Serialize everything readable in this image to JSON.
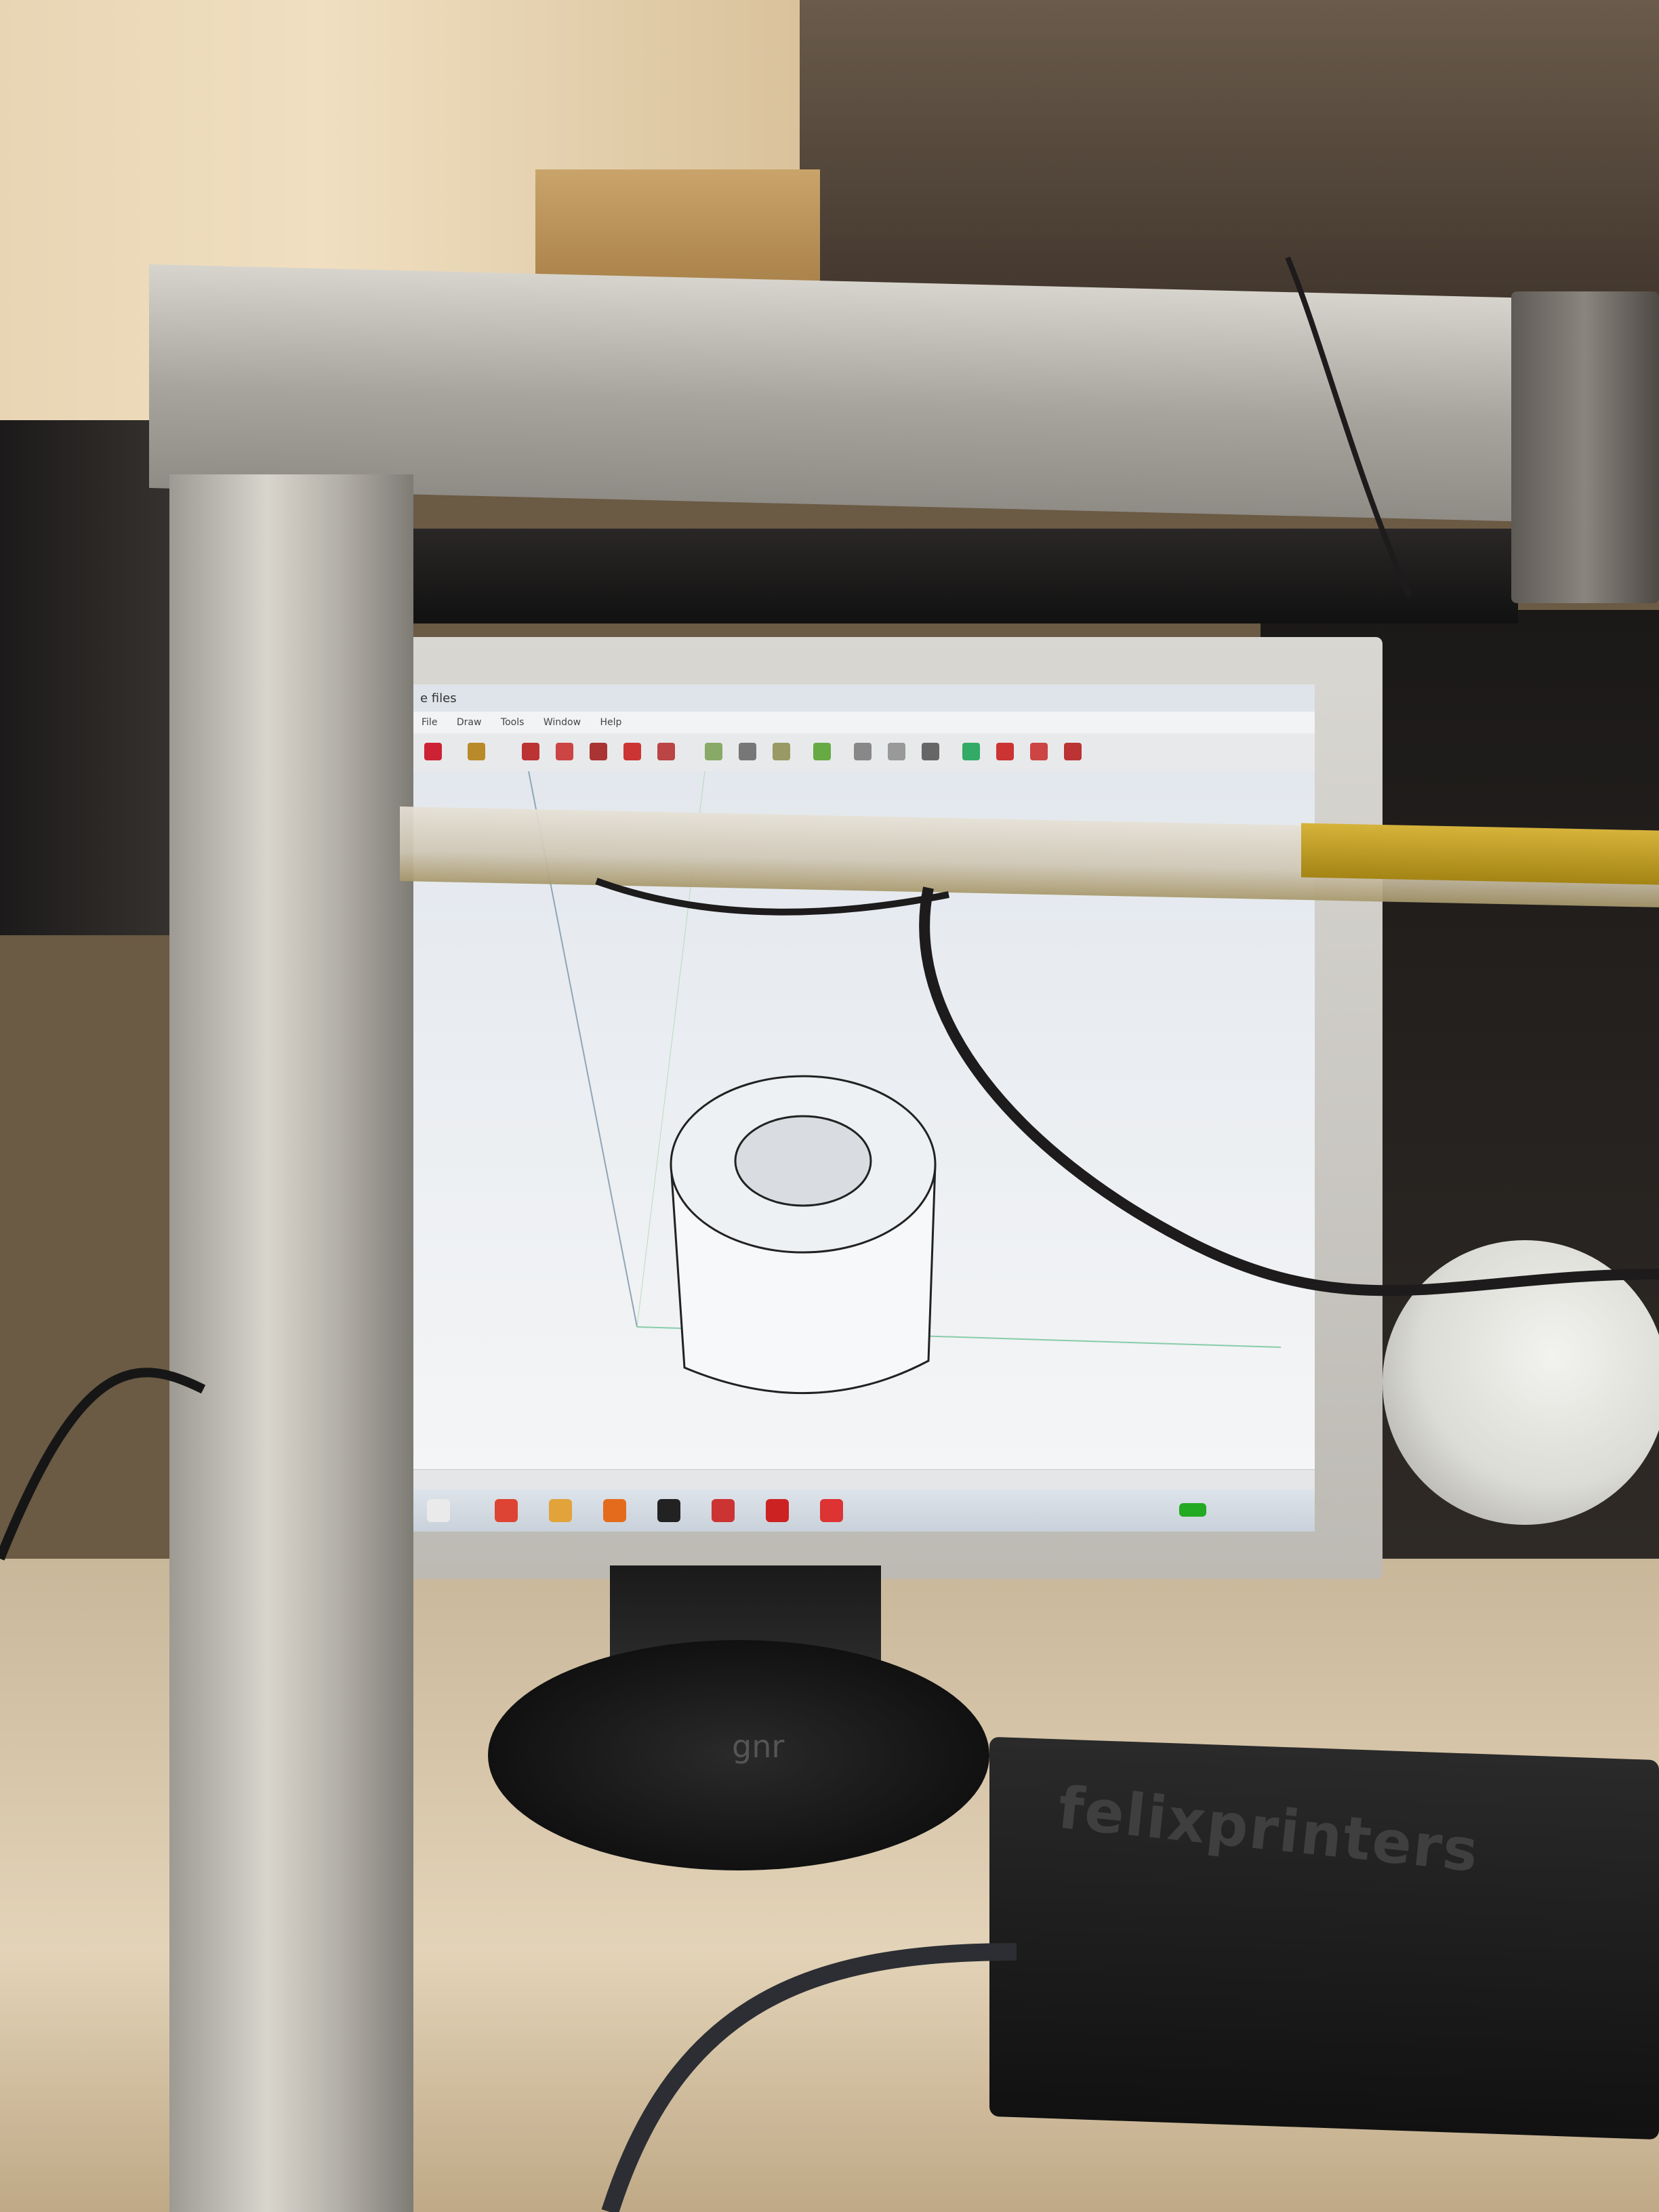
{
  "scene": {
    "description_tags": [
      "3d-printer-frame",
      "monitor",
      "cad-software",
      "filament-spool",
      "electronics-box"
    ],
    "colors": {
      "frame_aluminium": "#c8c5be",
      "bed_yellow": "#c9a327",
      "screen_bg": "#eceef0",
      "model_fill": "#f7f8fa",
      "model_edge": "#222222"
    }
  },
  "screen": {
    "title": "e files",
    "menu": [
      "File",
      "Draw",
      "Tools",
      "Window",
      "Help"
    ],
    "taskbar_icons": [
      "start-icon",
      "chrome-icon",
      "vlc-icon",
      "firefox-icon",
      "terminal-icon",
      "app-icon",
      "acrobat-icon",
      "app2-icon"
    ]
  },
  "stand": {
    "logo": "gnr"
  },
  "electronics_box": {
    "label": "felixprinters"
  }
}
